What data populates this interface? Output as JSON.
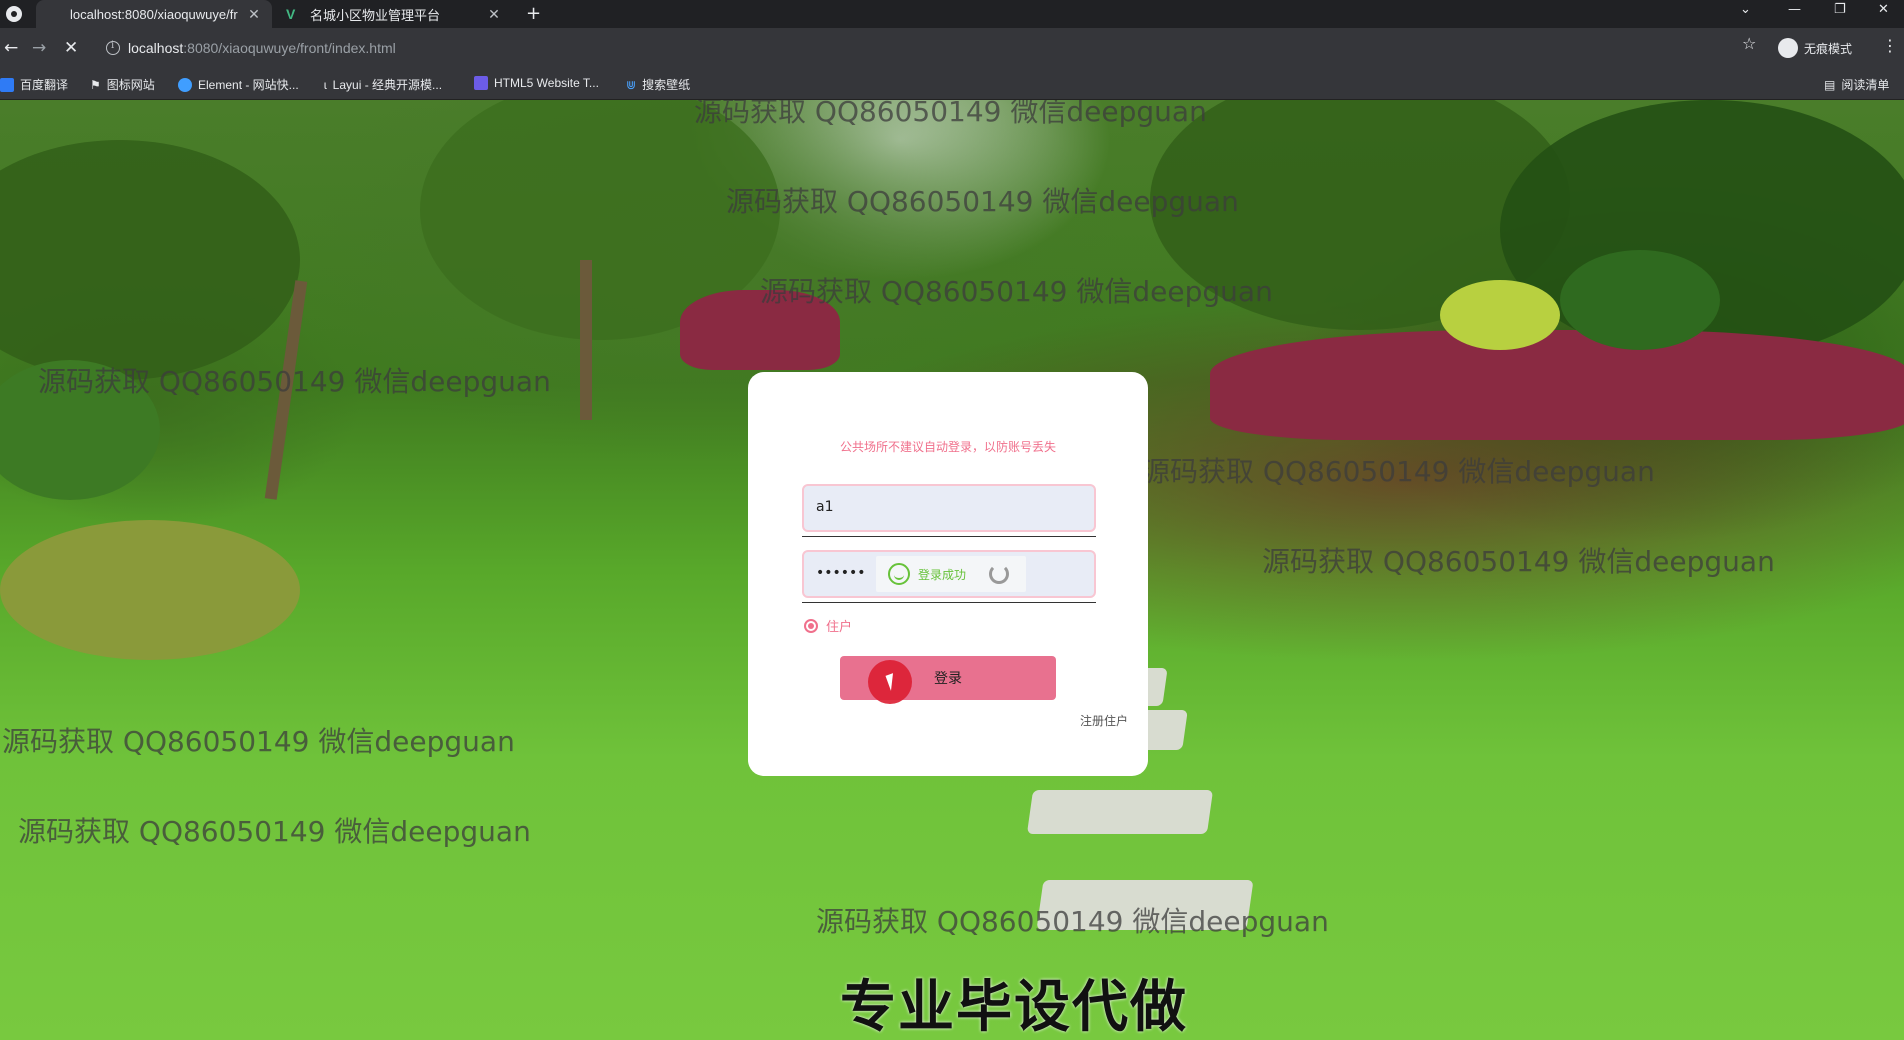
{
  "browser": {
    "tabs": [
      {
        "title": "localhost:8080/xiaoquwuye/fr",
        "active": true
      },
      {
        "title": "名城小区物业管理平台",
        "active": false
      }
    ],
    "url_host": "localhost",
    "url_path": ":8080/xiaoquwuye/front/index.html",
    "incognito_label": "无痕模式",
    "reading_list_label": "阅读清单",
    "bookmarks": [
      {
        "label": "百度翻译",
        "icon": "baidu-translate-icon",
        "color": "#2f7bf5"
      },
      {
        "label": "图标网站",
        "icon": "flag-icon",
        "color": "#e8eaed"
      },
      {
        "label": "Element - 网站快...",
        "icon": "element-icon",
        "color": "#409eff"
      },
      {
        "label": "Layui - 经典开源模...",
        "icon": "layui-icon",
        "color": "#e8eaed"
      },
      {
        "label": "HTML5 Website T...",
        "icon": "html5-icon",
        "color": "#6c5ce7"
      },
      {
        "label": "搜索壁纸",
        "icon": "wallpaper-icon",
        "color": "#4aa3ff"
      }
    ]
  },
  "login": {
    "tip": "公共场所不建议自动登录，以防账号丢失",
    "username_value": "a1",
    "password_value": "••••••",
    "toast_text": "登录成功",
    "role_label": "住户",
    "submit_label": "登录",
    "register_label": "注册住户"
  },
  "watermark_text": "源码获取 QQ86050149 微信deepguan",
  "caption": "专业毕设代做",
  "colors": {
    "accent": "#e8718f",
    "tip": "#f0708c",
    "success": "#67c23a"
  }
}
